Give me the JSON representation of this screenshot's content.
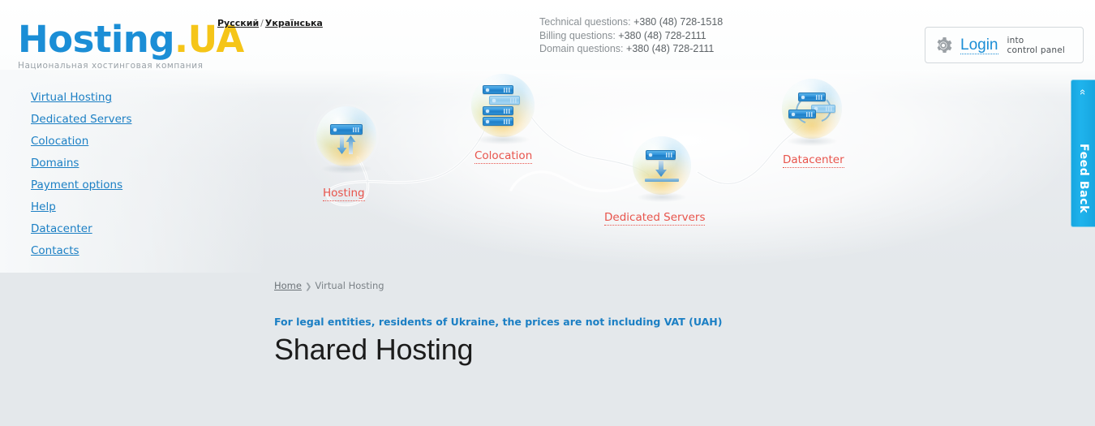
{
  "header": {
    "logo": {
      "primary": "Hosting",
      "dot": ".",
      "suffix": "UA"
    },
    "tagline": "Национальная хостинговая компания",
    "languages": {
      "ru": "Русский",
      "separator": "/",
      "ua": "Українська"
    },
    "contacts": [
      {
        "label": "Technical questions:",
        "number": "+380 (48) 728-1518"
      },
      {
        "label": "Billing questions:",
        "number": "+380 (48) 728-2111"
      },
      {
        "label": "Domain questions:",
        "number": "+380 (48) 728-2111"
      }
    ],
    "login": {
      "icon": "gear-icon",
      "label": "Login",
      "sub_line1": "into",
      "sub_line2": "control panel"
    }
  },
  "sidebar": {
    "items": [
      {
        "label": "Virtual Hosting"
      },
      {
        "label": "Dedicated Servers"
      },
      {
        "label": "Colocation"
      },
      {
        "label": "Domains"
      },
      {
        "label": "Payment options"
      },
      {
        "label": "Help"
      },
      {
        "label": "Datacenter"
      },
      {
        "label": "Contacts"
      }
    ]
  },
  "diagram": {
    "nodes": [
      {
        "id": "hosting",
        "label": "Hosting",
        "icon": "server-updown-icon"
      },
      {
        "id": "colocation",
        "label": "Colocation",
        "icon": "server-stack-icon"
      },
      {
        "id": "dedicated",
        "label": "Dedicated Servers",
        "icon": "server-download-icon"
      },
      {
        "id": "datacenter",
        "label": "Datacenter",
        "icon": "server-cluster-icon"
      }
    ]
  },
  "feedback": {
    "label": "Feed Back",
    "chevron": "«"
  },
  "content": {
    "breadcrumb": {
      "home": "Home",
      "separator": "❯",
      "current": "Virtual Hosting"
    },
    "vat_note": "For legal entities, residents of Ukraine, the prices are not including VAT (UAH)",
    "title": "Shared Hosting"
  },
  "colors": {
    "brand_blue": "#1b8ed6",
    "brand_yellow": "#f5c518",
    "link_blue": "#1b7fc4",
    "label_red": "#e8544c",
    "feedback_blue": "#1fb3ec",
    "page_bg": "#e4e8eb"
  }
}
